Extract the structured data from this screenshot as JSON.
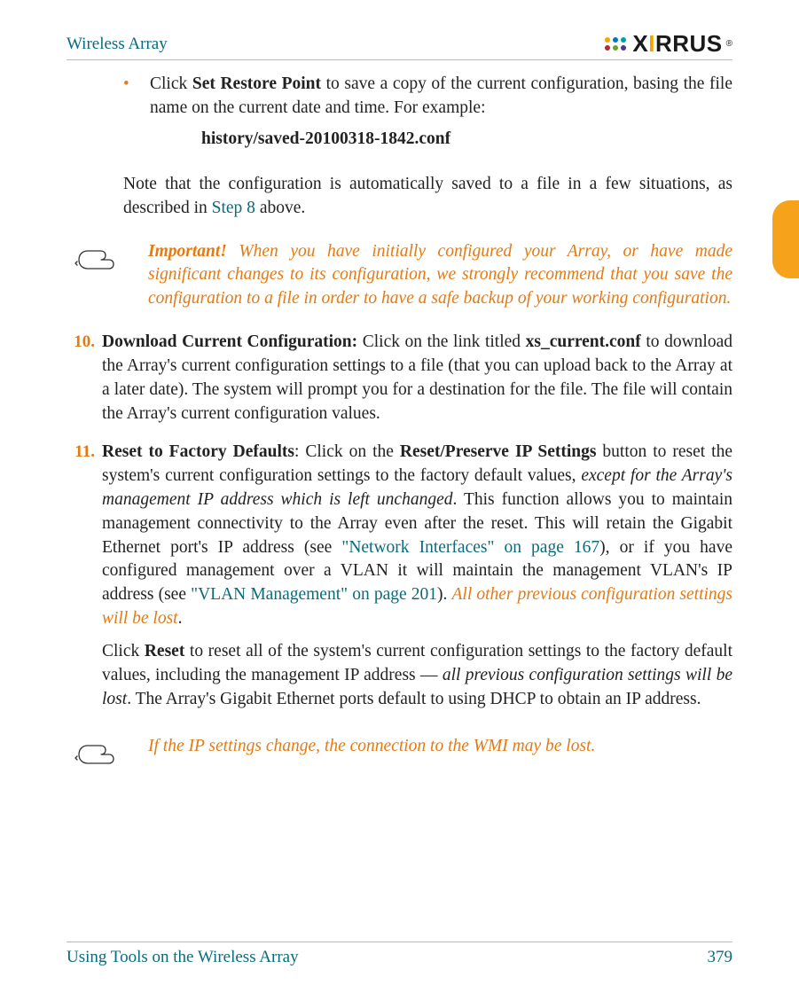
{
  "header": {
    "title": "Wireless Array",
    "logo_text": "XIRRUS",
    "logo_reg": "®"
  },
  "bullet": {
    "lead": "Click ",
    "bold": "Set Restore Point",
    "rest": " to save a copy of the current configuration, basing the file name on the current date and time. For example:",
    "example": "history/saved-20100318-1842.conf"
  },
  "note_after": {
    "pre": "Note that the configuration is automatically saved to a file in a few situations, as described in ",
    "link": "Step 8",
    "post": " above."
  },
  "quote1": {
    "imp": "Important!",
    "text": " When you have initially configured your Array, or have made significant changes to its configuration, we strongly recommend that you save the configuration to a file in order to have a safe backup of your working configuration."
  },
  "step10": {
    "num": "10.",
    "title_a": "Download Current Configuration:",
    "t1": " Click on the link titled ",
    "file": "xs_current.conf",
    "t2": " to download the Array's current configuration settings to a file (that you can upload back to the Array at a later date). The system will prompt you for a destination for the file. The file will contain the Array's current configuration values."
  },
  "step11": {
    "num": "11.",
    "title": "Reset to Factory Defaults",
    "t1": ": Click on the ",
    "btn": "Reset/Preserve IP Settings",
    "t2": " button to reset the system's current configuration settings to the factory default values, ",
    "ital1": "except for the Array's management IP address which is left unchanged",
    "t3": ". This function allows you to maintain management connectivity to the Array even after the reset. This will retain the Gigabit Ethernet port's IP address (see ",
    "link1": "\"Network Interfaces\" on page 167",
    "t4": "), or if you have configured management over a VLAN it will maintain the management VLAN's IP address (see ",
    "link2": "\"VLAN Management\" on page 201",
    "t5": "). ",
    "ital2": "All other previous configuration settings will be lost",
    "t6": ".",
    "p2a": "Click ",
    "p2btn": "Reset",
    "p2b": " to reset all of the system's current configuration settings to the factory default values, including the management IP address — ",
    "p2ital": "all previous configuration settings will be lost",
    "p2c": ". The Array's Gigabit Ethernet ports default to using DHCP to obtain an IP address."
  },
  "quote2": {
    "text": "If the IP settings change, the connection to the WMI may be lost."
  },
  "footer": {
    "left": "Using Tools on the Wireless Array",
    "right": "379"
  }
}
